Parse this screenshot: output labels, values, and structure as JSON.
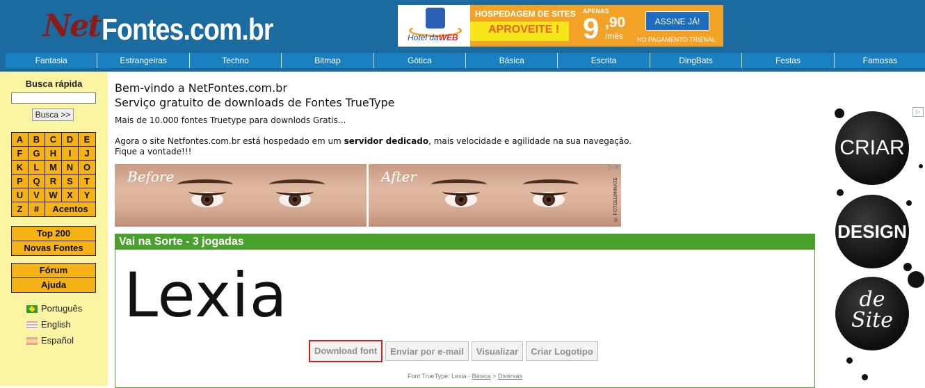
{
  "header": {
    "logo": {
      "net": "Net",
      "fontes": "Fontes.com.br"
    },
    "banner": {
      "brand_prefix": "Hotel da",
      "brand_suffix": "WEB",
      "hospedagem": "HOSPEDAGEM DE SITES",
      "aproveite": "APROVEITE !",
      "apenas": "APENAS",
      "price_big": "9",
      "price_cents": ",90",
      "per_month": "/mês",
      "cta": "ASSINE JÁ!",
      "note": "NO PAGAMENTO TRIENAL"
    },
    "nav": [
      "Fantasia",
      "Estrangeiras",
      "Techno",
      "Bitmap",
      "Gótica",
      "Básica",
      "Escrita",
      "DingBats",
      "Festas",
      "Famosas"
    ]
  },
  "sidebar": {
    "busca_label": "Busca rápida",
    "busca_value": "",
    "busca_button": "Busca >>",
    "letters": [
      "A",
      "B",
      "C",
      "D",
      "E",
      "F",
      "G",
      "H",
      "I",
      "J",
      "K",
      "L",
      "M",
      "N",
      "O",
      "P",
      "Q",
      "R",
      "S",
      "T",
      "U",
      "V",
      "W",
      "X",
      "Y",
      "Z",
      "#"
    ],
    "acentos": "Acentos",
    "box1": [
      "Top 200",
      "Novas Fontes"
    ],
    "box2": [
      "Fórum",
      "Ajuda"
    ],
    "languages": [
      "Português",
      "English",
      "Español"
    ]
  },
  "main": {
    "welcome_line1": "Bem-vindo a NetFontes.com.br",
    "welcome_line2": "Serviço gratuito de downloads de Fontes TrueType",
    "intro": "Mais de 10.000 fontes Truetype para downlods Gratis...",
    "dedic_prefix": "Agora o site Netfontes.com.br está hospedado em um ",
    "dedic_bold": "servidor dedicado",
    "dedic_suffix": ", mais velocidade e agilidade na sua navegação.",
    "dedic_line2": "Fique a vontade!!!",
    "ad_before": "Before",
    "ad_after": "After",
    "ad_watermark": "© FOTOLUMINATE",
    "ad_choice": "▷✕"
  },
  "sorte": {
    "title": "Vai na Sorte - 3 jogadas",
    "font_preview": "Lexia",
    "buttons": [
      "Download font",
      "Enviar por e-mail",
      "Visualizar",
      "Criar Logotipo"
    ],
    "meta_prefix": "Font TrueType: Lexia - ",
    "meta_cat1": "Básica",
    "meta_sep": " > ",
    "meta_cat2": "Diversas"
  },
  "right_ad": {
    "word1": "CRIAR",
    "word2": "DESIGN",
    "word3a": "de",
    "word3b": "Site",
    "choice": "▷"
  }
}
